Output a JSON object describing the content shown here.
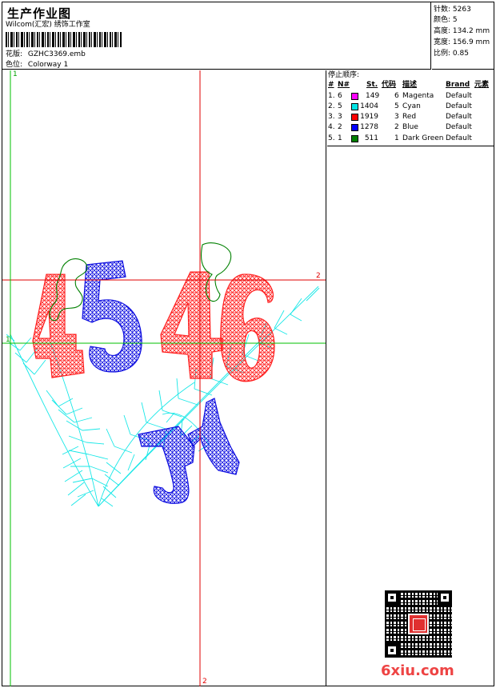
{
  "header": {
    "title": "生产作业图",
    "company": "Wilcom(汇宏) 绣饰工作室",
    "design_label": "花版:",
    "design_value": "GZHC3369.emb",
    "colorway_label": "色位:",
    "colorway_value": "Colorway 1"
  },
  "stats": [
    {
      "label": "针数:",
      "value": "5263"
    },
    {
      "label": "颜色:",
      "value": "5"
    },
    {
      "label": "高度:",
      "value": "134.2 mm"
    },
    {
      "label": "宽度:",
      "value": "156.9 mm"
    },
    {
      "label": "比例:",
      "value": "0.85"
    }
  ],
  "stop_sequence": {
    "title": "停止顺序:",
    "headers": {
      "num": "#",
      "needle": "N#",
      "stitches": "St.",
      "code": "代码",
      "desc": "描述",
      "brand": "Brand",
      "element": "元素"
    },
    "rows": [
      {
        "num": "1.",
        "needle": "6",
        "color": "#ff00ff",
        "stitches": "149",
        "code": "6",
        "desc": "Magenta",
        "brand": "Default"
      },
      {
        "num": "2.",
        "needle": "5",
        "color": "#00e5e5",
        "stitches": "1404",
        "code": "5",
        "desc": "Cyan",
        "brand": "Default"
      },
      {
        "num": "3.",
        "needle": "3",
        "color": "#ff0000",
        "stitches": "1919",
        "code": "3",
        "desc": "Red",
        "brand": "Default"
      },
      {
        "num": "4.",
        "needle": "2",
        "color": "#0000ff",
        "stitches": "1278",
        "code": "2",
        "desc": "Blue",
        "brand": "Default"
      },
      {
        "num": "5.",
        "needle": "1",
        "color": "#008000",
        "stitches": "511",
        "code": "1",
        "desc": "Dark Green",
        "brand": "Default"
      }
    ]
  },
  "canvas": {
    "axis_labels": {
      "top_left": "1",
      "left_mid": "1",
      "right_mid": "2",
      "bottom_mid": "2"
    },
    "design_text_top": "4546",
    "design_text_bottom": "JJ"
  },
  "watermark": {
    "text": "6xiu.com"
  },
  "colors": {
    "red_axis": "#e00000",
    "green_axis": "#00c000",
    "cyan": "#00e5e5",
    "red": "#ff2020",
    "blue": "#1010e0",
    "green": "#008000"
  }
}
